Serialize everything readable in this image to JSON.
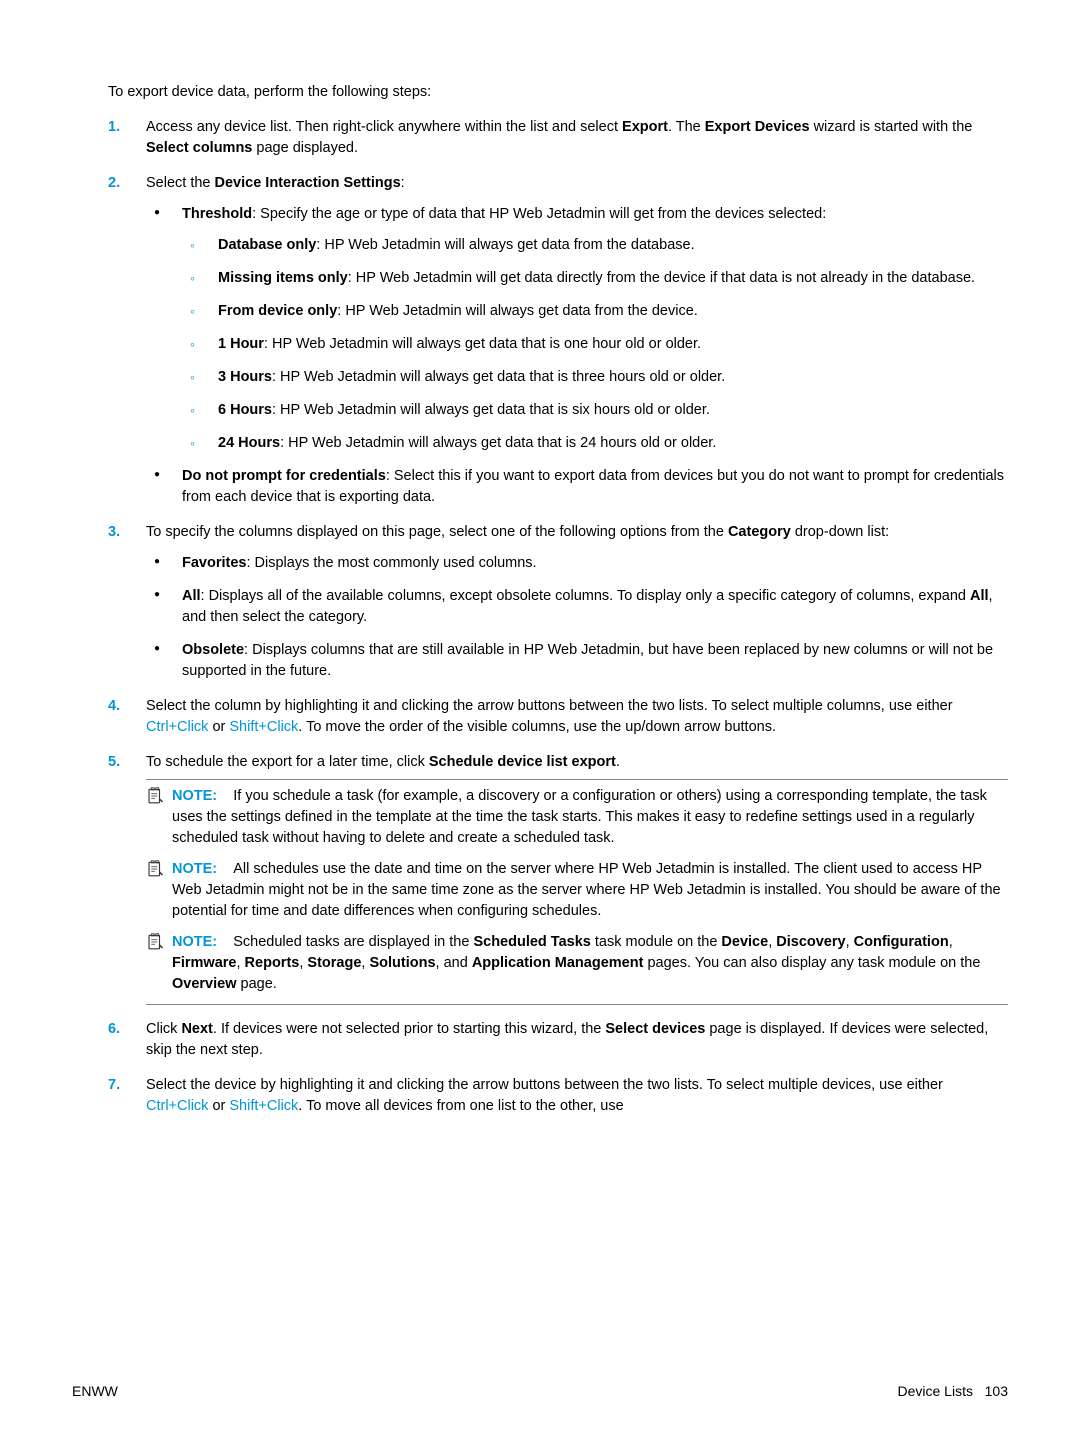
{
  "intro": "To export device data, perform the following steps:",
  "steps": {
    "s1": {
      "num": "1.",
      "text_a": "Access any device list. Then right-click anywhere within the list and select ",
      "b1": "Export",
      "text_b": ". The ",
      "b2": "Export Devices",
      "text_c": " wizard is started with the ",
      "b3": "Select columns",
      "text_d": " page displayed."
    },
    "s2": {
      "num": "2.",
      "text_a": "Select the ",
      "b1": "Device Interaction Settings",
      "text_b": ":",
      "threshold_b": "Threshold",
      "threshold_t": ": Specify the age or type of data that HP Web Jetadmin will get from the devices selected:",
      "db_b": "Database only",
      "db_t": ": HP Web Jetadmin will always get data from the database.",
      "mi_b": "Missing items only",
      "mi_t": ": HP Web Jetadmin will get data directly from the device if that data is not already in the database.",
      "fd_b": "From device only",
      "fd_t": ": HP Web Jetadmin will always get data from the device.",
      "h1_b": "1 Hour",
      "h1_t": ": HP Web Jetadmin will always get data that is one hour old or older.",
      "h3_b": "3 Hours",
      "h3_t": ": HP Web Jetadmin will always get data that is three hours old or older.",
      "h6_b": "6 Hours",
      "h6_t": ": HP Web Jetadmin will always get data that is six hours old or older.",
      "h24_b": "24 Hours",
      "h24_t": ": HP Web Jetadmin will always get data that is 24 hours old or older.",
      "dnp_b": "Do not prompt for credentials",
      "dnp_t": ": Select this if you want to export data from devices but you do not want to prompt for credentials from each device that is exporting data."
    },
    "s3": {
      "num": "3.",
      "text_a": "To specify the columns displayed on this page, select one of the following options from the ",
      "b1": "Category",
      "text_b": " drop-down list:",
      "fav_b": "Favorites",
      "fav_t": ": Displays the most commonly used columns.",
      "all_b": "All",
      "all_t1": ": Displays all of the available columns, except obsolete columns. To display only a specific category of columns, expand ",
      "all_b2": "All",
      "all_t2": ", and then select the category.",
      "obs_b": "Obsolete",
      "obs_t": ": Displays columns that are still available in HP Web Jetadmin, but have been replaced by new columns or will not be supported in the future."
    },
    "s4": {
      "num": "4.",
      "text_a": "Select the column by highlighting it and clicking the arrow buttons between the two lists. To select multiple columns, use either ",
      "k1": "Ctrl+Click",
      "text_b": " or ",
      "k2": "Shift+Click",
      "text_c": ". To move the order of the visible columns, use the up/down arrow buttons."
    },
    "s5": {
      "num": "5.",
      "text_a": "To schedule the export for a later time, click ",
      "b1": "Schedule device list export",
      "text_b": ".",
      "note_label": "NOTE:",
      "n1": "If you schedule a task (for example, a discovery or a configuration or others) using a corresponding template, the task uses the settings defined in the template at the time the task starts. This makes it easy to redefine settings used in a regularly scheduled task without having to delete and create a scheduled task.",
      "n2": "All schedules use the date and time on the server where HP Web Jetadmin is installed. The client used to access HP Web Jetadmin might not be in the same time zone as the server where HP Web Jetadmin is installed. You should be aware of the potential for time and date differences when configuring schedules.",
      "n3_a": "Scheduled tasks are displayed in the ",
      "n3_b1": "Scheduled Tasks",
      "n3_b": " task module on the ",
      "n3_b2": "Device",
      "n3_c": ", ",
      "n3_b3": "Discovery",
      "n3_d": ", ",
      "n3_b4": "Configuration",
      "n3_e": ", ",
      "n3_b5": "Firmware",
      "n3_f": ", ",
      "n3_b6": "Reports",
      "n3_g": ", ",
      "n3_b7": "Storage",
      "n3_h": ", ",
      "n3_b8": "Solutions",
      "n3_i": ", and ",
      "n3_b9": "Application Management",
      "n3_j": " pages. You can also display any task module on the ",
      "n3_b10": "Overview",
      "n3_k": " page."
    },
    "s6": {
      "num": "6.",
      "text_a": "Click ",
      "b1": "Next",
      "text_b": ". If devices were not selected prior to starting this wizard, the ",
      "b2": "Select devices",
      "text_c": " page is displayed. If devices were selected, skip the next step."
    },
    "s7": {
      "num": "7.",
      "text_a": "Select the device by highlighting it and clicking the arrow buttons between the two lists. To select multiple devices, use either ",
      "k1": "Ctrl+Click",
      "text_b": " or ",
      "k2": "Shift+Click",
      "text_c": ". To move all devices from one list to the other, use"
    }
  },
  "footer": {
    "left": "ENWW",
    "right_label": "Device Lists",
    "right_page": "103"
  }
}
